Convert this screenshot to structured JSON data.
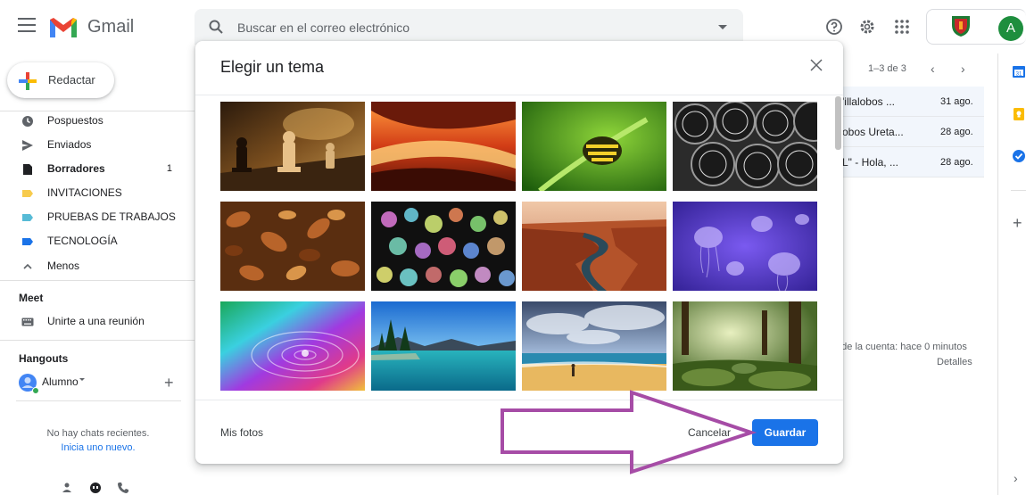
{
  "app": {
    "name": "Gmail",
    "search_placeholder": "Buscar en el correo electrónico",
    "avatar_letter": "A"
  },
  "sidebar": {
    "compose_label": "Redactar",
    "items": [
      {
        "label": "Pospuestos",
        "icon": "clock-icon",
        "count": ""
      },
      {
        "label": "Enviados",
        "icon": "send-icon",
        "count": ""
      },
      {
        "label": "Borradores",
        "icon": "draft-icon",
        "count": "1"
      },
      {
        "label": "INVITACIONES",
        "icon": "label-icon",
        "color": "#f7cb4d",
        "count": ""
      },
      {
        "label": "PRUEBAS DE TRABAJOS",
        "icon": "label-icon",
        "color": "#57bbd6",
        "count": ""
      },
      {
        "label": "TECNOLOGÍA",
        "icon": "label-icon",
        "color": "#1a73e8",
        "count": ""
      },
      {
        "label": "Menos",
        "icon": "chevron-up-icon",
        "count": ""
      }
    ],
    "meet": {
      "title": "Meet",
      "join_label": "Unirte a una reunión"
    },
    "hangouts": {
      "title": "Hangouts",
      "user": "Alumno",
      "no_chats": "No hay chats recientes.",
      "start_new": "Inicia uno nuevo."
    }
  },
  "mail_list": {
    "pagination": "1–3 de 3",
    "rows": [
      {
        "sender": "'illalobos ...",
        "date": "31 ago."
      },
      {
        "sender": "obos Ureta...",
        "date": "28 ago."
      },
      {
        "sender": "L\" - Hola, ...",
        "date": "28 ago."
      }
    ],
    "activity": "d de la cuenta: hace 0 minutos",
    "details": "Detalles"
  },
  "modal": {
    "title": "Elegir un tema",
    "themes": [
      {
        "name": "chess"
      },
      {
        "name": "canyon-light"
      },
      {
        "name": "caterpillar"
      },
      {
        "name": "pipes"
      },
      {
        "name": "autumn-leaves"
      },
      {
        "name": "bokeh-lights"
      },
      {
        "name": "canyon-river"
      },
      {
        "name": "jellyfish"
      },
      {
        "name": "rainbow-water"
      },
      {
        "name": "lake-trees"
      },
      {
        "name": "beach"
      },
      {
        "name": "forest"
      }
    ],
    "my_photos": "Mis fotos",
    "cancel": "Cancelar",
    "save": "Guardar"
  },
  "colors": {
    "accent": "#1a73e8",
    "annotation_arrow": "#a64ca6"
  }
}
